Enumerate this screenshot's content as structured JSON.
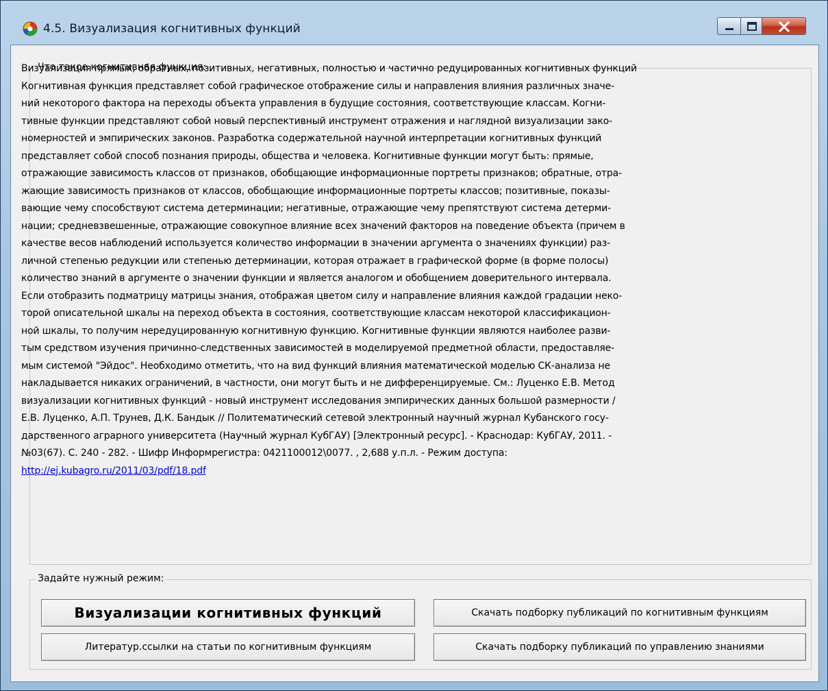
{
  "window": {
    "title": "4.5. Визуализация когнитивных функций",
    "controls": {
      "minimize": "minimize",
      "maximize": "maximize",
      "close": "close"
    }
  },
  "description_group": {
    "title": "Что такое когнитивная функция:",
    "lines": [
      "Визуализация прямых, обратных, позитивных, негативных, полностью и частично редуцированных когнитивных функций",
      "Когнитивная функция представляет собой графическое отображение силы и направления влияния различных значе-",
      "ний некоторого фактора на переходы объекта управления в будущие состояния, соответствующие классам. Когни-",
      "тивные функции представляют собой новый перспективный инструмент отражения и наглядной визуализации зако-",
      "номерностей и эмпирических законов. Разработка содержательной научной интерпретации когнитивных функций",
      "представляет собой способ познания природы, общества и человека. Когнитивные функции могут быть: прямые,",
      "отражающие зависимость классов от признаков, обобщающие информационные портреты признаков; обратные, отра-",
      "жающие зависимость признаков от классов, обобщающие информационные портреты классов; позитивные, показы-",
      "вающие чему способствуют система детерминации; негативные, отражающие чему препятствуют система детерми-",
      "нации; средневзвешенные, отражающие совокупное влияние всех значений факторов на поведение объекта (причем в",
      "качестве весов наблюдений используется количество информации в значении аргумента о значениях функции) раз-",
      "личной степенью редукции или степенью детерминации, которая отражает в графической форме (в форме полосы)",
      "количество знаний в аргументе о значении функции и является аналогом и обобщением доверительного интервала.",
      "Если отобразить подматрицу матрицы знания, отображая цветом силу и направление влияния каждой градации неко-",
      "торой описательной шкалы на переход объекта в состояния, соответствующие классам некоторой классификацион-",
      "ной шкалы, то получим нередуцированную когнитивную функцию. Когнитивные функции являются наиболее разви-",
      "тым средством изучения причинно-следственных зависимостей в моделируемой предметной области, предоставляе-",
      "мым системой \"Эйдос\". Необходимо отметить, что на вид функций влияния математической моделью СК-анализа не",
      "накладывается никаких ограничений, в частности, они могут быть и не дифференцируемые. См.: Луценко Е.В. Метод",
      "визуализации когнитивных функций - новый инструмент исследования эмпирических данных большой размерности /",
      "Е.В. Луценко, А.П. Трунев, Д.К. Бандык // Политематический сетевой электронный научный журнал Кубанского госу-",
      "дарственного аграрного университета (Научный журнал КубГАУ) [Электронный ресурс]. - Краснодар: КубГАУ, 2011. -",
      "№03(67). С. 240 - 282. - Шифр Информрегистра: 0421100012\\0077. , 2,688 у.п.л. - Режим доступа:"
    ],
    "link": "http://ej.kubagro.ru/2011/03/pdf/18.pdf"
  },
  "mode_group": {
    "title": "Задайте нужный режим:",
    "buttons": {
      "visualize": "Визуализации когнитивных функций",
      "download_cognitive": "Скачать подборку публикаций по когнитивным функциям",
      "literature": "Литератур.ссылки на статьи по когнитивным функциям",
      "download_knowledge": "Скачать подборку публикаций по управлению  знаниями"
    }
  }
}
